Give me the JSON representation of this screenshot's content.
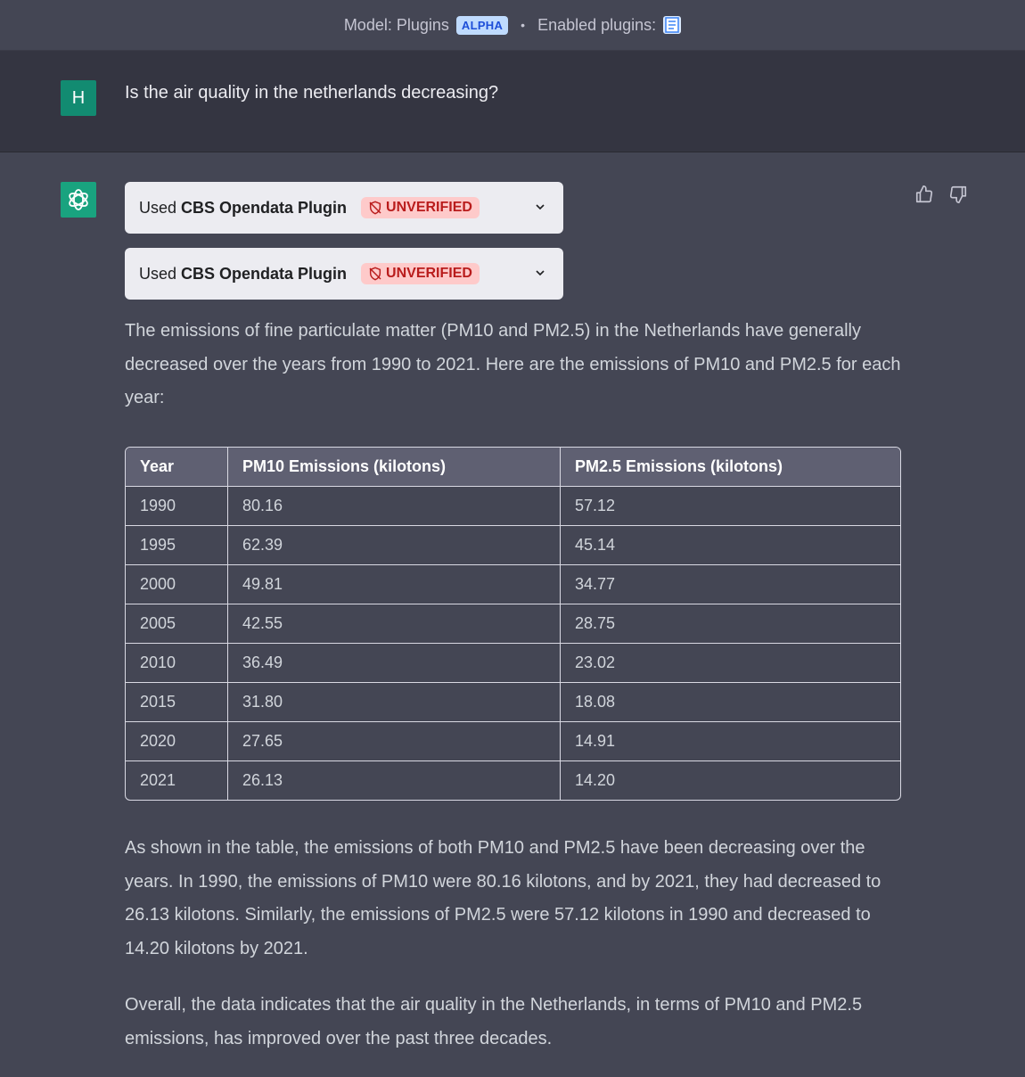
{
  "topbar": {
    "model_label": "Model: Plugins",
    "alpha_badge": "ALPHA",
    "separator": "•",
    "enabled_label": "Enabled plugins:",
    "plugin_icon": "document-icon"
  },
  "user": {
    "avatar_letter": "H",
    "avatar_color": "#128b71",
    "message": "Is the air quality in the netherlands decreasing?"
  },
  "assistant": {
    "avatar_color": "#19a37f",
    "plugins": [
      {
        "used_label": "Used",
        "plugin_name": "CBS Opendata Plugin",
        "status": "UNVERIFIED"
      },
      {
        "used_label": "Used",
        "plugin_name": "CBS Opendata Plugin",
        "status": "UNVERIFIED"
      }
    ],
    "intro": "The emissions of fine particulate matter (PM10 and PM2.5) in the Netherlands have generally decreased over the years from 1990 to 2021. Here are the emissions of PM10 and PM2.5 for each year:",
    "table": {
      "headers": [
        "Year",
        "PM10 Emissions (kilotons)",
        "PM2.5 Emissions (kilotons)"
      ],
      "rows": [
        [
          "1990",
          "80.16",
          "57.12"
        ],
        [
          "1995",
          "62.39",
          "45.14"
        ],
        [
          "2000",
          "49.81",
          "34.77"
        ],
        [
          "2005",
          "42.55",
          "28.75"
        ],
        [
          "2010",
          "36.49",
          "23.02"
        ],
        [
          "2015",
          "31.80",
          "18.08"
        ],
        [
          "2020",
          "27.65",
          "14.91"
        ],
        [
          "2021",
          "26.13",
          "14.20"
        ]
      ]
    },
    "analysis": "As shown in the table, the emissions of both PM10 and PM2.5 have been decreasing over the years. In 1990, the emissions of PM10 were 80.16 kilotons, and by 2021, they had decreased to 26.13 kilotons. Similarly, the emissions of PM2.5 were 57.12 kilotons in 1990 and decreased to 14.20 kilotons by 2021.",
    "conclusion": "Overall, the data indicates that the air quality in the Netherlands, in terms of PM10 and PM2.5 emissions, has improved over the past three decades."
  },
  "colors": {
    "background": "#444654",
    "user_row": "#343541",
    "unverified_bg": "#fecaca",
    "unverified_text": "#b91c1c"
  }
}
